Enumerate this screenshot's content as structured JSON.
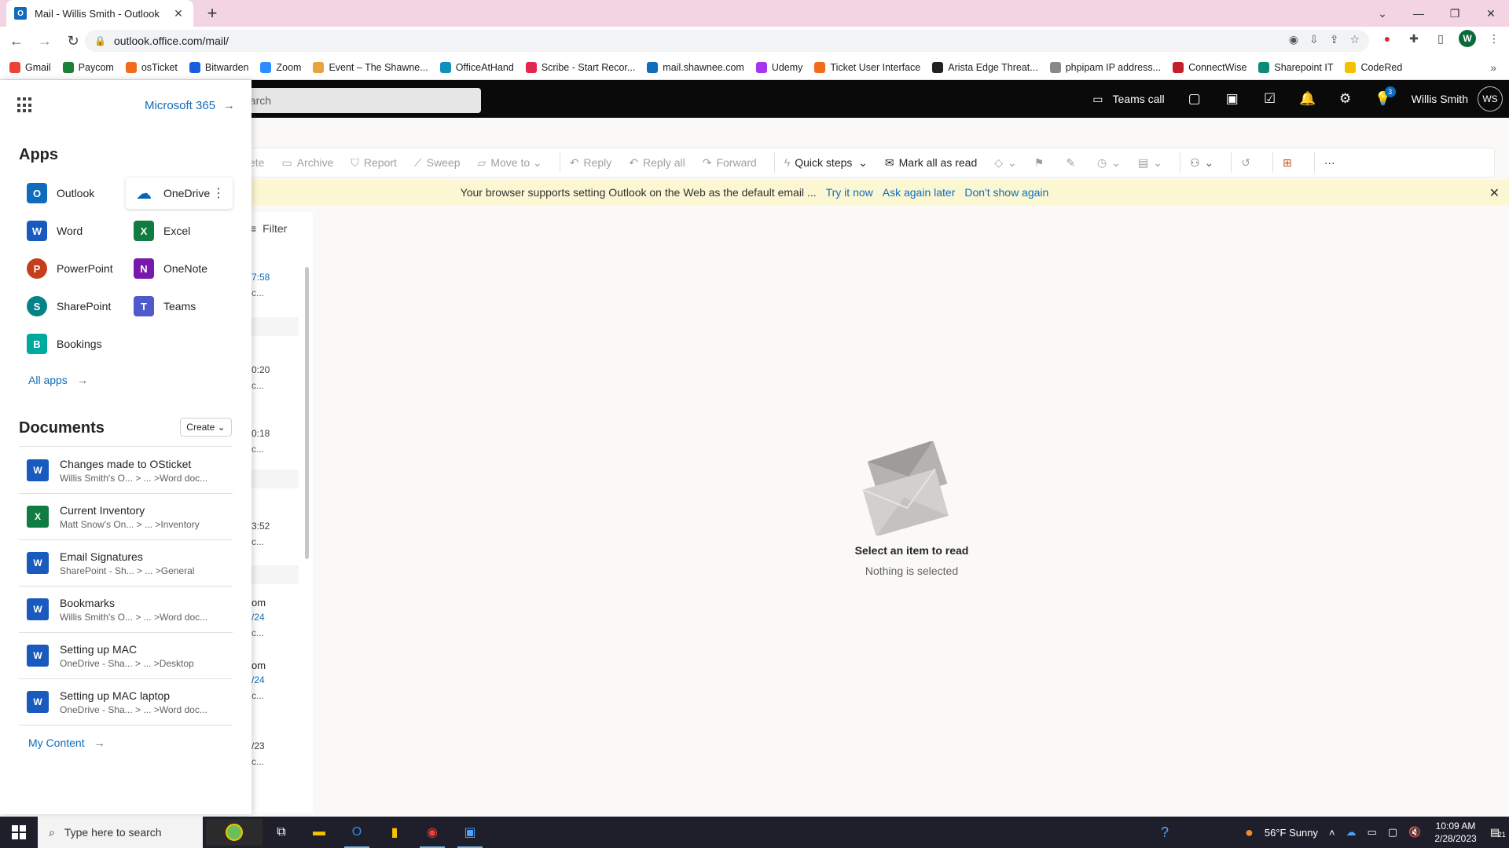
{
  "browser": {
    "tab_title": "Mail - Willis Smith - Outlook",
    "url": "outlook.office.com/mail/",
    "bookmarks": [
      "Gmail",
      "Paycom",
      "osTicket",
      "Bitwarden",
      "Zoom",
      "Event – The Shawne...",
      "OfficeAtHand",
      "Scribe - Start Recor...",
      "mail.shawnee.com",
      "Udemy",
      "Ticket User Interface",
      "Arista Edge Threat...",
      "phpipam IP address...",
      "ConnectWise",
      "Sharepoint IT",
      "CodeRed"
    ],
    "bookmark_colors": [
      "#ea4335",
      "#1a7f37",
      "#f26b1d",
      "#175ddc",
      "#2d8cff",
      "#e8a33d",
      "#0f8fbd",
      "#e2264d",
      "#0f6cbd",
      "#a435f0",
      "#f26b1d",
      "#222222",
      "#888888",
      "#c21f2c",
      "#0b8a7a",
      "#f2c200"
    ],
    "profile_initial": "W"
  },
  "topbar": {
    "search_placeholder": "earch",
    "teams_call": "Teams call",
    "user_name": "Willis Smith",
    "user_initials": "WS",
    "tips_badge": "3"
  },
  "ribbon": {
    "delete": "ete",
    "archive": "Archive",
    "report": "Report",
    "sweep": "Sweep",
    "move_to": "Move to",
    "reply": "Reply",
    "reply_all": "Reply all",
    "forward": "Forward",
    "quick_steps": "Quick steps",
    "mark_all_read": "Mark all as read"
  },
  "infobar": {
    "message": "Your browser supports setting Outlook on the Web as the default email ...",
    "try_now": "Try it now",
    "ask_later": "Ask again later",
    "dont_show": "Don't show again"
  },
  "message_list": {
    "filter_label": "Filter",
    "rows": [
      {
        "time": "7:58",
        "snippet": "c..."
      },
      {
        "time": "0:20",
        "snippet": "c..."
      },
      {
        "time": "0:18",
        "snippet": "c..."
      },
      {
        "time": "3:52",
        "snippet": "c..."
      },
      {
        "time": "/24",
        "prefix": "om",
        "snippet": "c..."
      },
      {
        "time": "/24",
        "prefix": "om",
        "snippet": "c..."
      },
      {
        "time": "/23",
        "snippet": "c..."
      }
    ]
  },
  "reading_pane": {
    "title": "Select an item to read",
    "subtitle": "Nothing is selected"
  },
  "launcher": {
    "m365_link": "Microsoft 365",
    "apps_title": "Apps",
    "apps": [
      {
        "name": "Outlook",
        "letter": "O",
        "color": "#0f6cbd"
      },
      {
        "name": "OneDrive",
        "letter": "☁",
        "color": "#0364b8"
      },
      {
        "name": "Word",
        "letter": "W",
        "color": "#185abd"
      },
      {
        "name": "Excel",
        "letter": "X",
        "color": "#107c41"
      },
      {
        "name": "PowerPoint",
        "letter": "P",
        "color": "#c43e1c"
      },
      {
        "name": "OneNote",
        "letter": "N",
        "color": "#7719aa"
      },
      {
        "name": "SharePoint",
        "letter": "S",
        "color": "#038387"
      },
      {
        "name": "Teams",
        "letter": "T",
        "color": "#5059c9"
      },
      {
        "name": "Bookings",
        "letter": "B",
        "color": "#00a99d"
      }
    ],
    "all_apps": "All apps",
    "documents_title": "Documents",
    "create_label": "Create",
    "documents": [
      {
        "title": "Changes made to OSticket",
        "path": "Willis Smith's O... > ... >Word doc...",
        "type": "W",
        "color": "#185abd"
      },
      {
        "title": "Current Inventory",
        "path": "Matt Snow's On... > ... >Inventory",
        "type": "X",
        "color": "#107c41"
      },
      {
        "title": "Email Signatures",
        "path": "SharePoint - Sh... > ... >General",
        "type": "W",
        "color": "#185abd"
      },
      {
        "title": "Bookmarks",
        "path": "Willis Smith's O... > ... >Word doc...",
        "type": "W",
        "color": "#185abd"
      },
      {
        "title": "Setting up MAC",
        "path": "OneDrive - Sha... > ... >Desktop",
        "type": "W",
        "color": "#185abd"
      },
      {
        "title": "Setting up MAC laptop",
        "path": "OneDrive - Sha... > ... >Word doc...",
        "type": "W",
        "color": "#185abd"
      }
    ],
    "my_content": "My Content"
  },
  "taskbar": {
    "search_placeholder": "Type here to search",
    "weather": "56°F  Sunny",
    "time": "10:09 AM",
    "date": "2/28/2023",
    "notification_count": "21"
  }
}
